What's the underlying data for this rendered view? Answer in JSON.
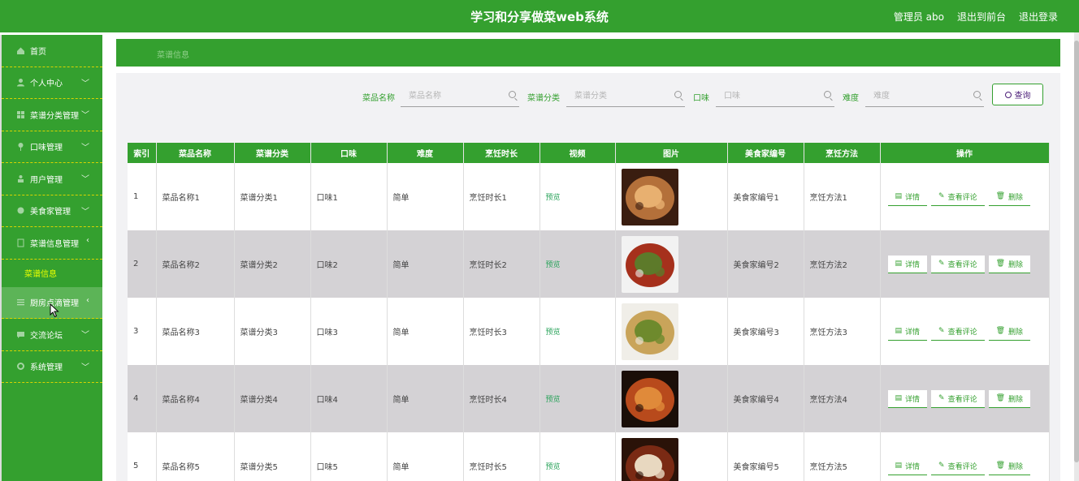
{
  "header": {
    "title": "学习和分享做菜web系统",
    "admin": "管理员 abo",
    "exit_front": "退出到前台",
    "logout": "退出登录"
  },
  "sidebar": {
    "items": [
      {
        "label": "首页",
        "icon": "home-icon",
        "chevron": ""
      },
      {
        "label": "个人中心",
        "icon": "user-icon",
        "chevron": "﹀"
      },
      {
        "label": "菜谱分类管理",
        "icon": "grid-icon",
        "chevron": "﹀"
      },
      {
        "label": "口味管理",
        "icon": "pin-icon",
        "chevron": "﹀"
      },
      {
        "label": "用户管理",
        "icon": "person-icon",
        "chevron": "﹀"
      },
      {
        "label": "美食家管理",
        "icon": "chef-icon",
        "chevron": "﹀"
      },
      {
        "label": "菜谱信息管理",
        "icon": "book-icon",
        "chevron": "‹"
      },
      {
        "label": "厨房点滴管理",
        "icon": "list-icon",
        "chevron": "‹"
      },
      {
        "label": "交流论坛",
        "icon": "chat-icon",
        "chevron": "﹀"
      },
      {
        "label": "系统管理",
        "icon": "gear-icon",
        "chevron": "﹀"
      }
    ],
    "sub_item": "菜谱信息"
  },
  "breadcrumb": "菜谱信息",
  "search": {
    "fields": [
      {
        "label": "菜品名称",
        "placeholder": "菜品名称"
      },
      {
        "label": "菜谱分类",
        "placeholder": "菜谱分类"
      },
      {
        "label": "口味",
        "placeholder": "口味"
      },
      {
        "label": "难度",
        "placeholder": "难度"
      }
    ],
    "button": "查询"
  },
  "table": {
    "headers": [
      "索引",
      "菜品名称",
      "菜谱分类",
      "口味",
      "难度",
      "烹饪时长",
      "视频",
      "图片",
      "美食家编号",
      "烹饪方法",
      "操作"
    ],
    "rows": [
      {
        "index": "1",
        "name": "菜品名称1",
        "category": "菜谱分类1",
        "taste": "口味1",
        "difficulty": "简单",
        "duration": "烹饪时长1",
        "video": "预览",
        "chef": "美食家编号1",
        "method": "烹饪方法1",
        "colors": [
          "#3a1d10",
          "#b4703a",
          "#e8b070"
        ]
      },
      {
        "index": "2",
        "name": "菜品名称2",
        "category": "菜谱分类2",
        "taste": "口味2",
        "difficulty": "简单",
        "duration": "烹饪时长2",
        "video": "预览",
        "chef": "美食家编号2",
        "method": "烹饪方法2",
        "colors": [
          "#f2f2f2",
          "#a6301c",
          "#5d7a2a"
        ]
      },
      {
        "index": "3",
        "name": "菜品名称3",
        "category": "菜谱分类3",
        "taste": "口味3",
        "difficulty": "简单",
        "duration": "烹饪时长3",
        "video": "预览",
        "chef": "美食家编号3",
        "method": "烹饪方法3",
        "colors": [
          "#f0eee8",
          "#c9a45a",
          "#6e8a2d"
        ]
      },
      {
        "index": "4",
        "name": "菜品名称4",
        "category": "菜谱分类4",
        "taste": "口味4",
        "difficulty": "简单",
        "duration": "烹饪时长4",
        "video": "预览",
        "chef": "美食家编号4",
        "method": "烹饪方法4",
        "colors": [
          "#1a0e08",
          "#b84a1c",
          "#e08a3a"
        ]
      },
      {
        "index": "5",
        "name": "菜品名称5",
        "category": "菜谱分类5",
        "taste": "口味5",
        "difficulty": "简单",
        "duration": "烹饪时长5",
        "video": "预览",
        "chef": "美食家编号5",
        "method": "烹饪方法5",
        "colors": [
          "#2a1208",
          "#7a2a14",
          "#e8d8c0"
        ]
      }
    ],
    "actions": {
      "detail": "详情",
      "comments": "查看评论",
      "delete": "删除"
    }
  },
  "colors": {
    "primary": "#34a02f",
    "alt_row": "#d4d2d5",
    "sub_active": "#eaff00"
  }
}
